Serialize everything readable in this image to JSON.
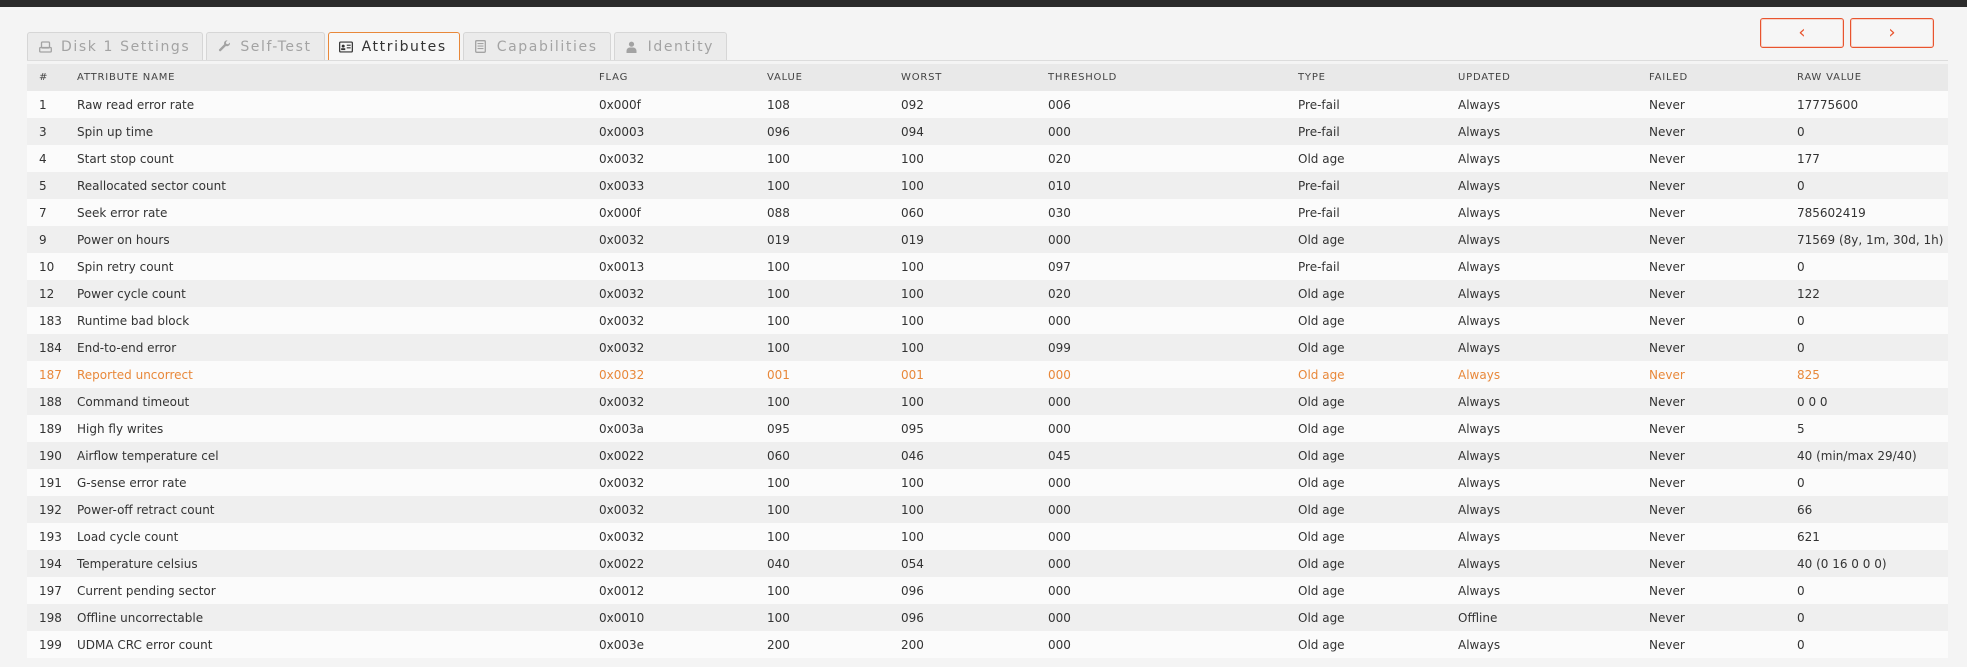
{
  "tabs": [
    {
      "label": "Disk 1 Settings",
      "icon": "drive-icon",
      "active": false
    },
    {
      "label": "Self-Test",
      "icon": "wrench-icon",
      "active": false
    },
    {
      "label": "Attributes",
      "icon": "id-card-icon",
      "active": true
    },
    {
      "label": "Capabilities",
      "icon": "document-icon",
      "active": false
    },
    {
      "label": "Identity",
      "icon": "user-icon",
      "active": false
    }
  ],
  "nav": {
    "prev": "‹",
    "next": "›"
  },
  "colors": {
    "accent": "#e8542e",
    "warning": "#e8883a"
  },
  "table": {
    "headers": [
      "#",
      "ATTRIBUTE NAME",
      "FLAG",
      "VALUE",
      "WORST",
      "THRESHOLD",
      "TYPE",
      "UPDATED",
      "FAILED",
      "RAW VALUE"
    ],
    "rows": [
      {
        "id": "1",
        "name": "Raw read error rate",
        "flag": "0x000f",
        "value": "108",
        "worst": "092",
        "threshold": "006",
        "type": "Pre-fail",
        "updated": "Always",
        "failed": "Never",
        "raw": "17775600",
        "warn": false
      },
      {
        "id": "3",
        "name": "Spin up time",
        "flag": "0x0003",
        "value": "096",
        "worst": "094",
        "threshold": "000",
        "type": "Pre-fail",
        "updated": "Always",
        "failed": "Never",
        "raw": "0",
        "warn": false
      },
      {
        "id": "4",
        "name": "Start stop count",
        "flag": "0x0032",
        "value": "100",
        "worst": "100",
        "threshold": "020",
        "type": "Old age",
        "updated": "Always",
        "failed": "Never",
        "raw": "177",
        "warn": false
      },
      {
        "id": "5",
        "name": "Reallocated sector count",
        "flag": "0x0033",
        "value": "100",
        "worst": "100",
        "threshold": "010",
        "type": "Pre-fail",
        "updated": "Always",
        "failed": "Never",
        "raw": "0",
        "warn": false
      },
      {
        "id": "7",
        "name": "Seek error rate",
        "flag": "0x000f",
        "value": "088",
        "worst": "060",
        "threshold": "030",
        "type": "Pre-fail",
        "updated": "Always",
        "failed": "Never",
        "raw": "785602419",
        "warn": false
      },
      {
        "id": "9",
        "name": "Power on hours",
        "flag": "0x0032",
        "value": "019",
        "worst": "019",
        "threshold": "000",
        "type": "Old age",
        "updated": "Always",
        "failed": "Never",
        "raw": "71569 (8y, 1m, 30d, 1h)",
        "warn": false
      },
      {
        "id": "10",
        "name": "Spin retry count",
        "flag": "0x0013",
        "value": "100",
        "worst": "100",
        "threshold": "097",
        "type": "Pre-fail",
        "updated": "Always",
        "failed": "Never",
        "raw": "0",
        "warn": false
      },
      {
        "id": "12",
        "name": "Power cycle count",
        "flag": "0x0032",
        "value": "100",
        "worst": "100",
        "threshold": "020",
        "type": "Old age",
        "updated": "Always",
        "failed": "Never",
        "raw": "122",
        "warn": false
      },
      {
        "id": "183",
        "name": "Runtime bad block",
        "flag": "0x0032",
        "value": "100",
        "worst": "100",
        "threshold": "000",
        "type": "Old age",
        "updated": "Always",
        "failed": "Never",
        "raw": "0",
        "warn": false
      },
      {
        "id": "184",
        "name": "End-to-end error",
        "flag": "0x0032",
        "value": "100",
        "worst": "100",
        "threshold": "099",
        "type": "Old age",
        "updated": "Always",
        "failed": "Never",
        "raw": "0",
        "warn": false
      },
      {
        "id": "187",
        "name": "Reported uncorrect",
        "flag": "0x0032",
        "value": "001",
        "worst": "001",
        "threshold": "000",
        "type": "Old age",
        "updated": "Always",
        "failed": "Never",
        "raw": "825",
        "warn": true
      },
      {
        "id": "188",
        "name": "Command timeout",
        "flag": "0x0032",
        "value": "100",
        "worst": "100",
        "threshold": "000",
        "type": "Old age",
        "updated": "Always",
        "failed": "Never",
        "raw": "0 0 0",
        "warn": false
      },
      {
        "id": "189",
        "name": "High fly writes",
        "flag": "0x003a",
        "value": "095",
        "worst": "095",
        "threshold": "000",
        "type": "Old age",
        "updated": "Always",
        "failed": "Never",
        "raw": "5",
        "warn": false
      },
      {
        "id": "190",
        "name": "Airflow temperature cel",
        "flag": "0x0022",
        "value": "060",
        "worst": "046",
        "threshold": "045",
        "type": "Old age",
        "updated": "Always",
        "failed": "Never",
        "raw": "40 (min/max 29/40)",
        "warn": false
      },
      {
        "id": "191",
        "name": "G-sense error rate",
        "flag": "0x0032",
        "value": "100",
        "worst": "100",
        "threshold": "000",
        "type": "Old age",
        "updated": "Always",
        "failed": "Never",
        "raw": "0",
        "warn": false
      },
      {
        "id": "192",
        "name": "Power-off retract count",
        "flag": "0x0032",
        "value": "100",
        "worst": "100",
        "threshold": "000",
        "type": "Old age",
        "updated": "Always",
        "failed": "Never",
        "raw": "66",
        "warn": false
      },
      {
        "id": "193",
        "name": "Load cycle count",
        "flag": "0x0032",
        "value": "100",
        "worst": "100",
        "threshold": "000",
        "type": "Old age",
        "updated": "Always",
        "failed": "Never",
        "raw": "621",
        "warn": false
      },
      {
        "id": "194",
        "name": "Temperature celsius",
        "flag": "0x0022",
        "value": "040",
        "worst": "054",
        "threshold": "000",
        "type": "Old age",
        "updated": "Always",
        "failed": "Never",
        "raw": "40 (0 16 0 0 0)",
        "warn": false
      },
      {
        "id": "197",
        "name": "Current pending sector",
        "flag": "0x0012",
        "value": "100",
        "worst": "096",
        "threshold": "000",
        "type": "Old age",
        "updated": "Always",
        "failed": "Never",
        "raw": "0",
        "warn": false
      },
      {
        "id": "198",
        "name": "Offline uncorrectable",
        "flag": "0x0010",
        "value": "100",
        "worst": "096",
        "threshold": "000",
        "type": "Old age",
        "updated": "Offline",
        "failed": "Never",
        "raw": "0",
        "warn": false
      },
      {
        "id": "199",
        "name": "UDMA CRC error count",
        "flag": "0x003e",
        "value": "200",
        "worst": "200",
        "threshold": "000",
        "type": "Old age",
        "updated": "Always",
        "failed": "Never",
        "raw": "0",
        "warn": false
      }
    ]
  }
}
